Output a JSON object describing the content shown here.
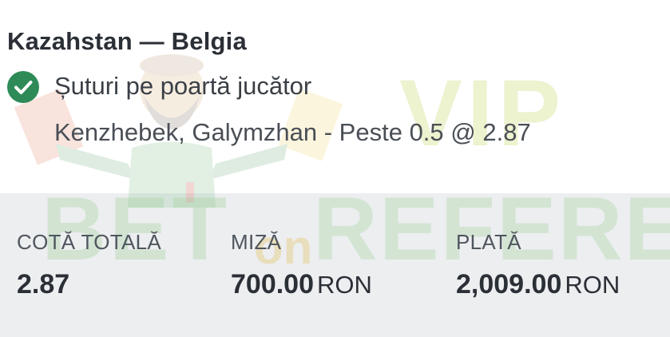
{
  "match": {
    "title": "Kazahstan — Belgia"
  },
  "bet": {
    "status_icon": "check-circle-icon",
    "status_color": "#2e8b57",
    "market": "Șuturi pe poartă jucător",
    "selection": "Kenzhebek, Galymzhan - Peste 0.5 @ 2.87"
  },
  "summary": {
    "total_odds_label": "COTĂ TOTALĂ",
    "total_odds_value": "2.87",
    "stake_label": "MIZĂ",
    "stake_value": "700.00",
    "stake_currency": "RON",
    "payout_label": "PLATĂ",
    "payout_value": "2,009.00",
    "payout_currency": "RON"
  },
  "watermark": {
    "line1": "VIP",
    "line2_left": "BET",
    "line2_mid": "on",
    "line2_right": "REFEREE"
  }
}
